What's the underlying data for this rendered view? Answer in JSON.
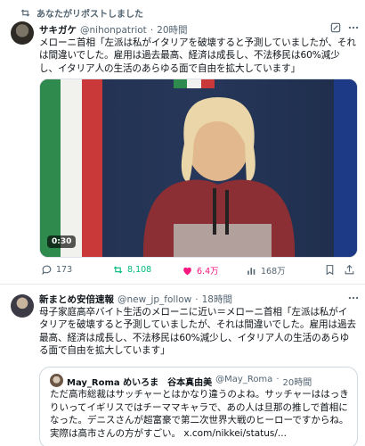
{
  "tweet1": {
    "repost_label": "あなたがリポストしました",
    "name": "サキガケ",
    "handle": "@nihonpatriot",
    "separator": "·",
    "time": "20時間",
    "text": "メローニ首相「左派は私がイタリアを破壊すると予測していましたが、それは間違いでした。雇用は過去最高、経済は成長し、不法移民は60%減少し、イタリア人の生活のあらゆる面で自由を拡大しています」",
    "video_duration": "0:30",
    "actions": {
      "replies": "173",
      "reposts": "8,108",
      "likes": "6.4万",
      "views": "168万"
    },
    "colors": {
      "repost_active": "#00ba7c",
      "like_active": "#f91880"
    }
  },
  "tweet2": {
    "name": "新まとめ安倍速報",
    "handle": "@new_jp_follow",
    "separator": "·",
    "time": "18時間",
    "text": "母子家庭高卒バイト生活のメローニに近い＝メローニ首相「左派は私がイタリアを破壊すると予測していましたが、それは間違いでした。雇用は過去最高、経済は成長し、不法移民は60%減少し、イタリア人の生活のあらゆる面で自由を拡大しています」",
    "quote": {
      "name": "May_Roma めいろま　谷本真由美",
      "handle": "@May_Roma",
      "separator": "·",
      "time": "20時間",
      "text": "ただ高市総裁はサッチャーとはかなり違うのよね。サッチャーははっきりいってイギリスではチーママキャラで、あの人は旦那の推しで首相になった。デニスさんが超富豪で第二次世界大戦のヒーローですからね。実際は高市さんの方がすごい。",
      "link": "x.com/nikkei/status/..."
    }
  },
  "icons": {
    "repost": "repost-icon",
    "reply": "reply-icon",
    "like": "heart-icon",
    "views": "views-icon",
    "bookmark": "bookmark-icon",
    "share": "share-icon",
    "grok": "grok-icon",
    "more": "more-icon"
  }
}
